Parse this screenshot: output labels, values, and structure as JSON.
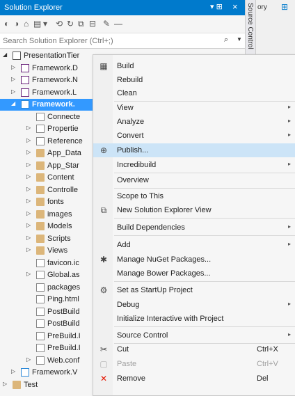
{
  "window": {
    "title": "Solution Explorer",
    "pin": "▾ ⊞",
    "close": "×",
    "side_tab": "Source Control",
    "right_tab": "ory"
  },
  "toolbar": {
    "items": [
      "◐",
      "◑",
      "⌂",
      "▤",
      "▾",
      "⟲",
      "↻",
      "⧉",
      "⊟",
      "✎",
      "—"
    ]
  },
  "search": {
    "placeholder": "Search Solution Explorer (Ctrl+;)",
    "icon": "search-icon"
  },
  "tree": [
    {
      "label": "PresentationTier",
      "expanded": true,
      "icon": "solution-folder"
    },
    {
      "label": "Framework.D",
      "icon": "csproj"
    },
    {
      "label": "Framework.N",
      "icon": "csproj"
    },
    {
      "label": "Framework.L",
      "icon": "csproj"
    },
    {
      "label": "Framework.",
      "icon": "webproj",
      "selected": true,
      "expanded": true
    },
    {
      "label": "Connecte",
      "icon": "connected"
    },
    {
      "label": "Propertie",
      "icon": "wrench"
    },
    {
      "label": "Reference",
      "icon": "references"
    },
    {
      "label": "App_Data",
      "icon": "folder"
    },
    {
      "label": "App_Star",
      "icon": "folder"
    },
    {
      "label": "Content",
      "icon": "folder"
    },
    {
      "label": "Controlle",
      "icon": "folder"
    },
    {
      "label": "fonts",
      "icon": "folder"
    },
    {
      "label": "images",
      "icon": "folder"
    },
    {
      "label": "Models",
      "icon": "folder"
    },
    {
      "label": "Scripts",
      "icon": "folder"
    },
    {
      "label": "Views",
      "icon": "folder"
    },
    {
      "label": "favicon.ic",
      "icon": "file"
    },
    {
      "label": "Global.as",
      "icon": "file"
    },
    {
      "label": "packages",
      "icon": "file"
    },
    {
      "label": "Ping.html",
      "icon": "file"
    },
    {
      "label": "PostBuild",
      "icon": "file"
    },
    {
      "label": "PostBuild",
      "icon": "file"
    },
    {
      "label": "PreBuild.I",
      "icon": "file"
    },
    {
      "label": "PreBuild.I",
      "icon": "file"
    },
    {
      "label": "Web.conf",
      "icon": "file"
    },
    {
      "label": "Framework.V",
      "icon": "webproj"
    },
    {
      "label": "Test",
      "icon": "folder"
    }
  ],
  "menu": {
    "items": [
      {
        "label": "Build",
        "icon": "build-icon",
        "glyph": "▦"
      },
      {
        "label": "Rebuild"
      },
      {
        "label": "Clean"
      },
      {
        "label": "View",
        "submenu": true
      },
      {
        "label": "Analyze",
        "submenu": true
      },
      {
        "label": "Convert",
        "submenu": true
      },
      {
        "label": "Publish...",
        "icon": "publish-icon",
        "glyph": "⊕",
        "highlighted": true
      },
      {
        "label": "Incredibuild",
        "submenu": true
      },
      {
        "label": "Overview"
      },
      {
        "label": "Scope to This"
      },
      {
        "label": "New Solution Explorer View",
        "icon": "new-view-icon",
        "glyph": "⧉"
      },
      {
        "label": "Build Dependencies",
        "submenu": true
      },
      {
        "label": "Add",
        "submenu": true
      },
      {
        "label": "Manage NuGet Packages...",
        "icon": "nuget-icon",
        "glyph": "✱"
      },
      {
        "label": "Manage Bower Packages..."
      },
      {
        "label": "Set as StartUp Project",
        "icon": "gear-icon",
        "glyph": "⚙"
      },
      {
        "label": "Debug",
        "submenu": true
      },
      {
        "label": "Initialize Interactive with Project"
      },
      {
        "label": "Source Control",
        "submenu": true
      },
      {
        "label": "Cut",
        "icon": "cut-icon",
        "glyph": "✂",
        "shortcut": "Ctrl+X"
      },
      {
        "label": "Paste",
        "icon": "paste-icon",
        "glyph": "▢",
        "shortcut": "Ctrl+V",
        "disabled": true
      },
      {
        "label": "Remove",
        "icon": "remove-icon",
        "glyph": "✕",
        "shortcut": "Del"
      }
    ]
  },
  "colors": {
    "accent": "#007acc",
    "selection": "#3399ff",
    "menu_highlight": "#cce4f7",
    "remove": "#e51400"
  }
}
